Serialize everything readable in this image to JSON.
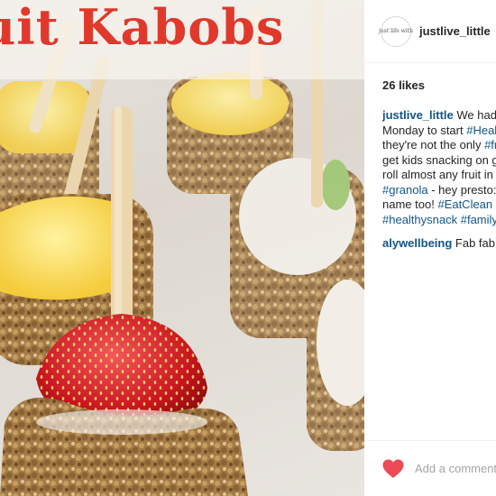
{
  "photo": {
    "title": "uit Kabobs",
    "image_description_icon": "fruit-kabobs-photo"
  },
  "post": {
    "username": "justlive_little",
    "avatar_text": "just life with",
    "likes": "26 likes",
    "caption": {
      "author": "justlive_little",
      "line1_text": " We had th",
      "line2_text": "Monday to start ",
      "line2_tag": "#Healt",
      "line3_text": "they're not the only ",
      "line3_tag": "#fr",
      "line4_text": "get kids snacking on g",
      "line5_text": "roll almost any fruit in ",
      "line5_tag": "#",
      "line6_tag": "#granola",
      "line6_text": " - hey presto: ",
      "line7_text": "name too! ",
      "line7_tag": "#EatClean",
      "line7_tag2": " #",
      "line8_tag": "#healthysnack",
      "line8_tag2": " #family"
    },
    "comment": {
      "author": "alywellbeing",
      "text": " Fab fab fa"
    },
    "like_icon": "heart-icon",
    "add_comment_placeholder": "Add a comment..."
  }
}
